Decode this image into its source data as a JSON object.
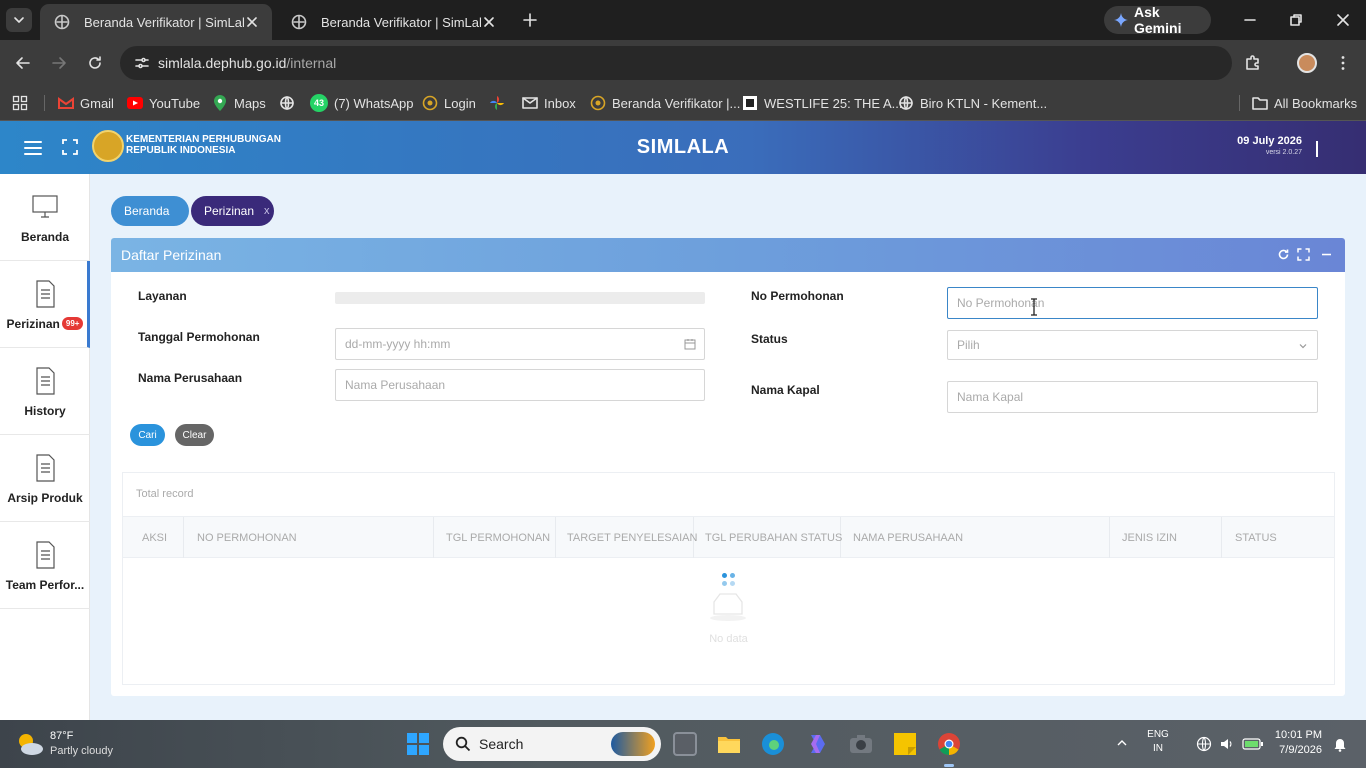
{
  "browser": {
    "tabs": [
      {
        "title": "Beranda Verifikator | SimLala",
        "active": true
      },
      {
        "title": "Beranda Verifikator | SimLala",
        "active": false
      }
    ],
    "gemini_label": "Ask Gemini",
    "url_host": "simlala.dephub.go.id",
    "url_path": "/internal",
    "bookmarks": [
      {
        "label": "Gmail",
        "icon": "gmail-icon"
      },
      {
        "label": "YouTube",
        "icon": "youtube-icon"
      },
      {
        "label": "Maps",
        "icon": "maps-icon"
      },
      {
        "label": "",
        "icon": "globe-icon"
      },
      {
        "label": "(7) WhatsApp",
        "icon": "whatsapp-icon",
        "badge": "43"
      },
      {
        "label": "Login",
        "icon": "ministry-logo-icon"
      },
      {
        "label": "",
        "icon": "pinwheel-icon"
      },
      {
        "label": "Inbox",
        "icon": "mail-icon"
      },
      {
        "label": "Beranda Verifikator |...",
        "icon": "ministry-logo-icon"
      },
      {
        "label": "WESTLIFE 25: THE A...",
        "icon": "ticket-icon"
      },
      {
        "label": "Biro KTLN - Kement...",
        "icon": "globe-icon"
      }
    ],
    "all_bookmarks_label": "All Bookmarks"
  },
  "app": {
    "org_line1": "KEMENTERIAN PERHUBUNGAN",
    "org_line2": "REPUBLIK INDONESIA",
    "title": "SIMLALA",
    "date": "09 July 2026",
    "version": "versi 2.0.27"
  },
  "sidebar": {
    "items": [
      {
        "label": "Beranda",
        "icon": "monitor-icon"
      },
      {
        "label": "Perizinan",
        "icon": "document-icon",
        "badge": "99+",
        "active": true
      },
      {
        "label": "History",
        "icon": "document-icon"
      },
      {
        "label": "Arsip Produk",
        "icon": "document-icon"
      },
      {
        "label": "Team Perfor...",
        "icon": "document-icon"
      }
    ]
  },
  "breadcrumb": {
    "home": "Beranda",
    "current": "Perizinan",
    "close_symbol": "x"
  },
  "panel": {
    "title": "Daftar Perizinan",
    "form": {
      "layanan_label": "Layanan",
      "tanggal_label": "Tanggal Permohonan",
      "tanggal_placeholder": "dd-mm-yyyy hh:mm",
      "nama_perusahaan_label": "Nama Perusahaan",
      "nama_perusahaan_placeholder": "Nama Perusahaan",
      "no_permohonan_label": "No Permohonan",
      "no_permohonan_placeholder": "No Permohonan",
      "status_label": "Status",
      "status_selected": "Pilih",
      "nama_kapal_label": "Nama Kapal",
      "nama_kapal_placeholder": "Nama Kapal"
    },
    "buttons": {
      "search": "Cari",
      "clear": "Clear"
    },
    "table": {
      "total_record_label": "Total record",
      "columns": [
        "AKSI",
        "NO PERMOHONAN",
        "TGL PERMOHONAN",
        "TARGET PENYELESAIAN",
        "TGL PERUBAHAN STATUS",
        "NAMA PERUSAHAAN",
        "JENIS IZIN",
        "STATUS"
      ],
      "empty_text": "No data",
      "loading": true
    }
  },
  "taskbar": {
    "weather_temp": "87°F",
    "weather_desc": "Partly cloudy",
    "search_placeholder": "Search",
    "lang_line1": "ENG",
    "lang_line2": "IN",
    "time": "10:01 PM",
    "date": "7/9/2026"
  },
  "colors": {
    "app_header_start": "#2d86c9",
    "app_header_end": "#362e72",
    "primary_button": "#2a93dc",
    "breadcrumb_active": "#3a2a7a",
    "badge": "#e53935"
  }
}
